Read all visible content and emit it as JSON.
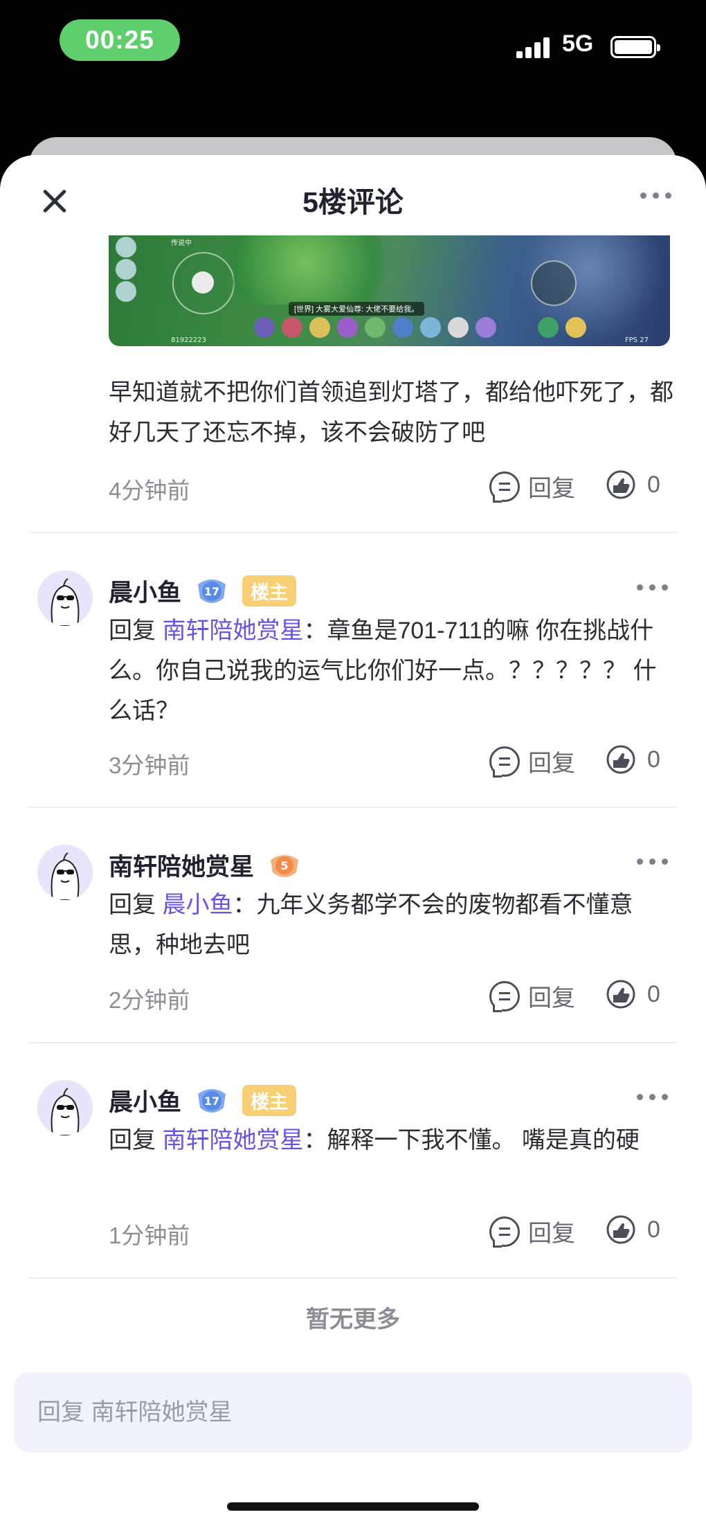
{
  "status_bar": {
    "time": "00:25",
    "network": "5G"
  },
  "header": {
    "title": "5楼评论"
  },
  "game_screenshot": {
    "top_left_text": "传说中",
    "chat_text": "[世界] 大雾大爱仙尊: 大佬不要给我。",
    "id_text": "81922223",
    "fps_text": "FPS 27"
  },
  "post": {
    "text": "早知道就不把你们首领追到灯塔了，都给他吓死了，都好几天了还忘不掉，该不会破防了吧",
    "time": "4分钟前",
    "reply_label": "回复",
    "like_count": "0"
  },
  "comments": [
    {
      "name": "晨小鱼",
      "level": "17",
      "tag": "楼主",
      "reply_prefix": "回复",
      "reply_target": "南轩陪她赏星",
      "text": "：章鱼是701-711的嘛 你在挑战什么。你自己说我的运气比你们好一点。？？？？？ 什么话？",
      "time": "3分钟前",
      "reply_label": "回复",
      "like_count": "0"
    },
    {
      "name": "南轩陪她赏星",
      "level": "5",
      "tag": "",
      "reply_prefix": "回复",
      "reply_target": "晨小鱼",
      "text": "：九年义务都学不会的废物都看不懂意思，种地去吧",
      "time": "2分钟前",
      "reply_label": "回复",
      "like_count": "0"
    },
    {
      "name": "晨小鱼",
      "level": "17",
      "tag": "楼主",
      "reply_prefix": "回复",
      "reply_target": "南轩陪她赏星",
      "text": "：解释一下我不懂。 嘴是真的硬",
      "time": "1分钟前",
      "reply_label": "回复",
      "like_count": "0"
    }
  ],
  "footer": {
    "no_more": "暂无更多",
    "input_placeholder": "回复 南轩陪她赏星"
  },
  "colors": {
    "accent": "#6a53e0",
    "time_pill": "#5fcf6e",
    "host_tag": "#f8cf74",
    "level_blue": "#7fa8f0",
    "level_orange": "#f28a4a"
  }
}
